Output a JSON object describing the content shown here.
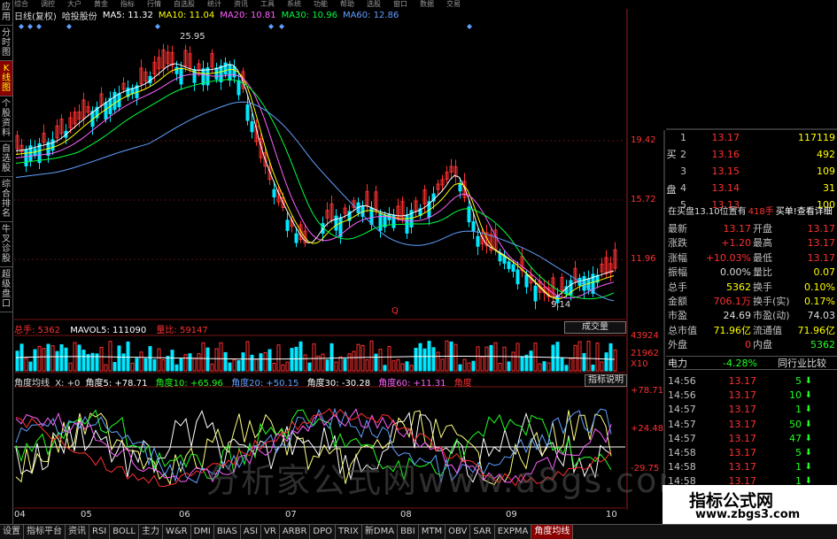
{
  "topbar": [
    "综合",
    "调控",
    "大户",
    "黄金",
    "指标",
    "行情",
    "自选股",
    "统计",
    "资讯",
    "工具",
    "系统",
    "功能",
    "帮助",
    "选股",
    "窗口",
    "数据",
    "交易"
  ],
  "sidebar": [
    {
      "label": "应用",
      "active": false
    },
    {
      "label": "分时图",
      "active": false
    },
    {
      "label": "K线图",
      "active": true
    },
    {
      "label": "个股资料",
      "active": false
    },
    {
      "label": "自选股",
      "active": false
    },
    {
      "label": "综合排名",
      "active": false
    },
    {
      "label": "牛叉诊股",
      "active": false
    },
    {
      "label": "超级盘口",
      "active": false
    }
  ],
  "ma_line": {
    "period": "日线(复权)",
    "name": "哈投股份",
    "ma5": "MA5: 11.32",
    "ma10": "MA10: 11.04",
    "ma20": "MA20: 10.81",
    "ma30": "MA30: 10.96",
    "ma60": "MA60: 12.86"
  },
  "price_axis": [
    "19.42",
    "15.72",
    "11.96"
  ],
  "annotations": {
    "high": "25.95",
    "low": "9.14",
    "mark": "Q"
  },
  "volume": {
    "label": "总手: 5362",
    "mavol": "MAVOL5: 111090",
    "ratio": "量比: 59147",
    "button": "成交量",
    "axis": [
      "43924",
      "21962",
      "X10"
    ]
  },
  "indicator": {
    "name": "角度均线",
    "x": "X: +0",
    "a5": "角度5: +78.71",
    "a10": "角度10: +65.96",
    "a20": "角度20: +50.15",
    "a30": "角度30: -30.28",
    "a60": "角度60: +11.31",
    "a_last": "角度",
    "button": "指标说明",
    "axis": [
      "+78.71",
      "+24.48",
      "-29.75"
    ]
  },
  "x_axis": [
    "04",
    "05",
    "06",
    "07",
    "08",
    "09",
    "10"
  ],
  "order_book": {
    "sell_side": "买盘",
    "rows": [
      {
        "n": "1",
        "price": "13.17",
        "vol": "117119"
      },
      {
        "n": "2",
        "price": "13.16",
        "vol": "492"
      },
      {
        "n": "3",
        "price": "13.15",
        "vol": "109"
      },
      {
        "n": "4",
        "price": "13.14",
        "vol": "31"
      },
      {
        "n": "5",
        "price": "13.13",
        "vol": "100"
      }
    ],
    "notice": "在买盘13.10位置有",
    "notice_qty": "418手",
    "notice_tail": "买单!查看详细"
  },
  "stats": [
    {
      "l": "最新",
      "v": "13.17",
      "l2": "开盘",
      "v2": "13.17"
    },
    {
      "l": "涨跌",
      "v": "+1.20",
      "l2": "最高",
      "v2": "13.17"
    },
    {
      "l": "涨幅",
      "v": "+10.03%",
      "l2": "最低",
      "v2": "13.17"
    },
    {
      "l": "振幅",
      "v": "0.00%",
      "l2": "量比",
      "v2": "0.07"
    },
    {
      "l": "总手",
      "v": "5362",
      "l2": "换手",
      "v2": "0.10%"
    },
    {
      "l": "金额",
      "v": "706.1万",
      "l2": "换手(实)",
      "v2": "0.17%"
    },
    {
      "l": "市盈",
      "v": "24.69",
      "l2": "市盈(动)",
      "v2": "74.03"
    },
    {
      "l": "总市值",
      "v": "71.96亿",
      "l2": "流通值",
      "v2": "71.96亿"
    },
    {
      "l": "外盘",
      "v": "0",
      "l2": "内盘",
      "v2": "5362"
    }
  ],
  "sector": {
    "name": "电力",
    "change": "-4.28%",
    "button": "同行业比较"
  },
  "ticks": [
    {
      "t": "14:56",
      "p": "13.17",
      "v": "5"
    },
    {
      "t": "14:56",
      "p": "13.17",
      "v": "10"
    },
    {
      "t": "14:57",
      "p": "13.17",
      "v": "1"
    },
    {
      "t": "14:57",
      "p": "13.17",
      "v": "50"
    },
    {
      "t": "14:57",
      "p": "13.17",
      "v": "47"
    },
    {
      "t": "14:58",
      "p": "13.17",
      "v": "5"
    },
    {
      "t": "14:58",
      "p": "13.17",
      "v": "1"
    },
    {
      "t": "14:58",
      "p": "13.17",
      "v": "1"
    }
  ],
  "tabs": [
    "设置",
    "指标平台",
    "资讯",
    "RSI",
    "BOLL",
    "主力",
    "W&R",
    "DMI",
    "BIAS",
    "ASI",
    "VR",
    "ARBR",
    "DPO",
    "TRIX",
    "新DMA",
    "BBI",
    "MTM",
    "OBV",
    "SAR",
    "EXPMA",
    "角度均线"
  ],
  "active_tab": "角度均线",
  "logo": {
    "title": "指标公式网",
    "url": "www.zbgs3.com"
  },
  "watermark": "分析家公式网www.a8gs.com",
  "colors": {
    "up": "#ff3030",
    "down": "#00e8ff",
    "ma5": "#ffffff",
    "ma10": "#ffff00",
    "ma20": "#ff60ff",
    "ma30": "#00ff40",
    "ma60": "#60a0ff"
  }
}
